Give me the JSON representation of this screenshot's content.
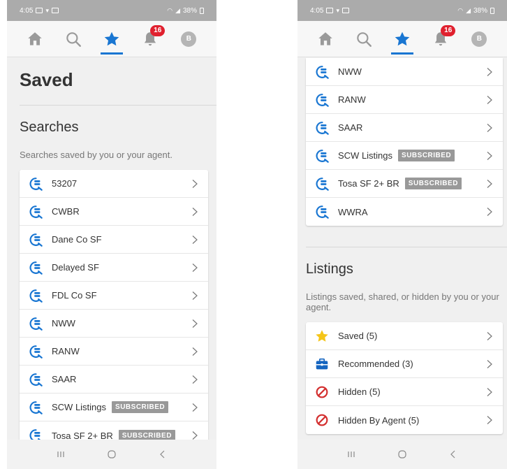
{
  "status": {
    "time": "4:05",
    "battery": "38%"
  },
  "nav": {
    "badge_count": "16",
    "avatar_initial": "B"
  },
  "left": {
    "page_title": "Saved",
    "searches_title": "Searches",
    "searches_desc": "Searches saved by you or your agent.",
    "searches": [
      {
        "label": "53207",
        "tag": ""
      },
      {
        "label": "CWBR",
        "tag": ""
      },
      {
        "label": "Dane Co SF",
        "tag": ""
      },
      {
        "label": "Delayed SF",
        "tag": ""
      },
      {
        "label": "FDL Co SF",
        "tag": ""
      },
      {
        "label": "NWW",
        "tag": ""
      },
      {
        "label": "RANW",
        "tag": ""
      },
      {
        "label": "SAAR",
        "tag": ""
      },
      {
        "label": "SCW Listings",
        "tag": "SUBSCRIBED"
      },
      {
        "label": "Tosa SF 2+ BR",
        "tag": "SUBSCRIBED"
      }
    ]
  },
  "right": {
    "searches": [
      {
        "label": "NWW",
        "tag": ""
      },
      {
        "label": "RANW",
        "tag": ""
      },
      {
        "label": "SAAR",
        "tag": ""
      },
      {
        "label": "SCW Listings",
        "tag": "SUBSCRIBED"
      },
      {
        "label": "Tosa SF 2+ BR",
        "tag": "SUBSCRIBED"
      },
      {
        "label": "WWRA",
        "tag": ""
      }
    ],
    "listings_title": "Listings",
    "listings_desc": "Listings saved, shared, or hidden by you or your agent.",
    "listings": [
      {
        "label": "Saved (5)",
        "icon": "star-icon"
      },
      {
        "label": "Recommended (3)",
        "icon": "briefcase-icon"
      },
      {
        "label": "Hidden (5)",
        "icon": "prohibited-icon"
      },
      {
        "label": "Hidden By Agent (5)",
        "icon": "prohibited-icon"
      }
    ]
  },
  "colors": {
    "accent": "#1976d2",
    "badge": "#e0202e",
    "star": "#f5c518",
    "briefcase": "#1565c0",
    "hidden": "#d32f2f",
    "tag": "#999999"
  }
}
